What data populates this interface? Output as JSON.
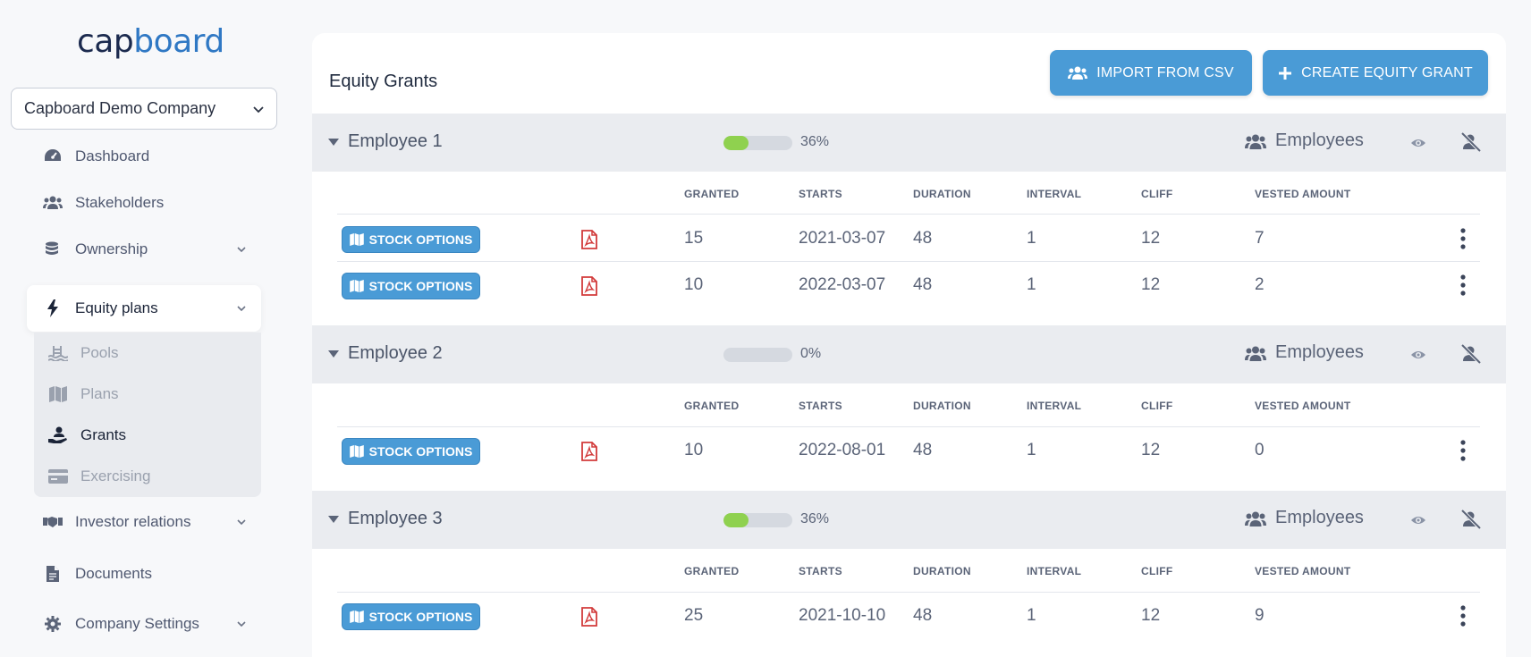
{
  "logo": {
    "part1": "cap",
    "part2": "board"
  },
  "company": {
    "selected": "Capboard Demo Company"
  },
  "nav": {
    "items": [
      {
        "label": "Dashboard"
      },
      {
        "label": "Stakeholders"
      },
      {
        "label": "Ownership"
      },
      {
        "label": "Equity plans"
      },
      {
        "label": "Investor relations"
      },
      {
        "label": "Documents"
      },
      {
        "label": "Company Settings"
      }
    ],
    "sub": [
      {
        "label": "Pools"
      },
      {
        "label": "Plans"
      },
      {
        "label": "Grants"
      },
      {
        "label": "Exercising"
      }
    ]
  },
  "main": {
    "title": "Equity Grants",
    "import_label": "IMPORT FROM CSV",
    "create_label": "CREATE EQUITY GRANT"
  },
  "columns": {
    "granted": "GRANTED",
    "starts": "STARTS",
    "duration": "DURATION",
    "interval": "INTERVAL",
    "cliff": "CLIFF",
    "vested": "VESTED AMOUNT"
  },
  "badge_label": "STOCK OPTIONS",
  "groups": [
    {
      "name": "Employee 1",
      "progress": 36,
      "progress_label": "36%",
      "category": "Employees",
      "rows": [
        {
          "granted": "15",
          "starts": "2021-03-07",
          "duration": "48",
          "interval": "1",
          "cliff": "12",
          "vested": "7"
        },
        {
          "granted": "10",
          "starts": "2022-03-07",
          "duration": "48",
          "interval": "1",
          "cliff": "12",
          "vested": "2"
        }
      ]
    },
    {
      "name": "Employee 2",
      "progress": 0,
      "progress_label": "0%",
      "category": "Employees",
      "rows": [
        {
          "granted": "10",
          "starts": "2022-08-01",
          "duration": "48",
          "interval": "1",
          "cliff": "12",
          "vested": "0"
        }
      ]
    },
    {
      "name": "Employee 3",
      "progress": 36,
      "progress_label": "36%",
      "category": "Employees",
      "rows": [
        {
          "granted": "25",
          "starts": "2021-10-10",
          "duration": "48",
          "interval": "1",
          "cliff": "12",
          "vested": "9"
        }
      ]
    }
  ],
  "colors": {
    "accent": "#4a9bd6",
    "progress": "#8fd14f",
    "pdf": "#d23b3b"
  }
}
